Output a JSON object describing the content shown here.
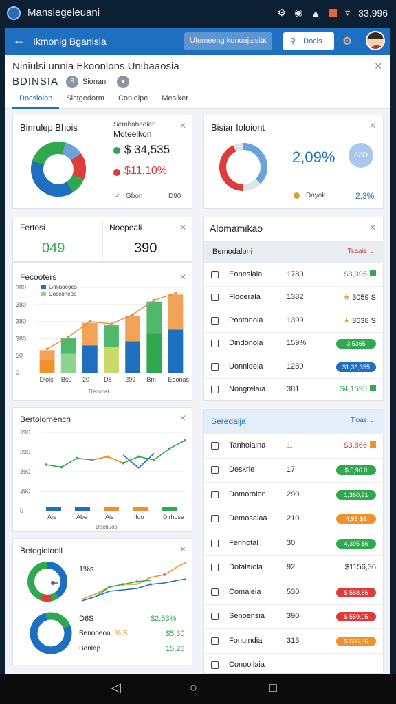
{
  "status": {
    "title": "Mansiegeleuani",
    "time": "33.996"
  },
  "appbar": {
    "title": "Ikmonig Bganisia",
    "search_placeholder": "Ufemeeng konoajaisin",
    "search_button": "Docis"
  },
  "header": {
    "line1": "Niniulsi unnia Ekoonlons Unibaaosia",
    "line2": "BDINSIA",
    "chip1_label": "Sionan",
    "tabs": [
      "Docsiolon",
      "Sictgedorm",
      "Conlolpe",
      "Mesiker"
    ]
  },
  "card_a": {
    "title": "Binrulep Bhois",
    "sub_title": "Sembabadien",
    "sub_title2": "Moteelkon",
    "value1": "$ 34,535",
    "value2": "$11,10%",
    "foot_left": "Gbon",
    "foot_right": "D90"
  },
  "card_b": {
    "title": "Bisiar Ioloiont",
    "percent": "2,09%",
    "pill": "32D",
    "foot_left": "Doyok",
    "foot_right": "2,3%"
  },
  "card_c": {
    "title": "Fertosi",
    "value": "049",
    "title2": "Noepeali",
    "value2": "390"
  },
  "card_bar": {
    "title": "Fecooters",
    "legend": [
      "Gmiuoeoes",
      "Cocconeoa"
    ],
    "yticks": [
      "380",
      "380",
      "380",
      "380",
      "50",
      "0"
    ],
    "xticks": [
      "Diols",
      "Bs0",
      "20",
      "D8",
      "209",
      "Bm",
      "Eeonas"
    ],
    "xlabel": "Decooet",
    "chart_data": {
      "type": "bar",
      "series": [
        {
          "name": "Gmiuoeoes",
          "values": [
            95,
            145,
            210,
            200,
            240,
            300,
            330
          ]
        },
        {
          "name": "Cocconeoa",
          "values": [
            0,
            120,
            0,
            150,
            0,
            290,
            270
          ]
        }
      ]
    }
  },
  "card_line": {
    "title": "Bertolomench",
    "yticks": [
      "390",
      "390",
      "390",
      "390",
      "0"
    ],
    "xticks": [
      "Ais",
      "Abe",
      "Ais",
      "Iloo",
      "Dirhosa"
    ],
    "xlabel": "Decbuos",
    "chart_data": {
      "type": "line",
      "series": [
        {
          "name": "",
          "values": [
            200,
            185,
            240,
            230,
            250,
            210,
            250,
            230,
            300,
            350
          ]
        },
        {
          "name": "",
          "values": [
            0,
            0,
            0,
            0,
            0,
            260,
            180,
            270,
            0,
            0
          ]
        }
      ]
    }
  },
  "card_mini": {
    "title": "Betogiolooil",
    "label_top": "1%s",
    "bottom_label": "D6S",
    "bottom_value": "$2,53%",
    "row1_label": "Benooeon",
    "row1_sub": "% S",
    "row1_value": "$5,30",
    "row2_label": "Benlap",
    "row2_value": "15,26"
  },
  "table1": {
    "title": "Alomamikao",
    "header_left": "Bemodalpni",
    "header_right": "Tsaais",
    "rows": [
      {
        "name": "Eonesiala",
        "value": "1780",
        "right": "$3,395",
        "style": "green-text"
      },
      {
        "name": "Flooerala",
        "value": "1382",
        "right": "3059 S",
        "style": "star"
      },
      {
        "name": "Pontonola",
        "value": "1399",
        "right": "3638 S",
        "style": "star"
      },
      {
        "name": "Dindonola",
        "value": "159%",
        "right": "3,5365",
        "style": "badge-green"
      },
      {
        "name": "Uonnidela",
        "value": "1280",
        "right": "$1,36,355",
        "style": "badge-blue"
      },
      {
        "name": "Nongrelaia",
        "value": "381",
        "right": "$4,1595",
        "style": "green-text"
      }
    ]
  },
  "table2": {
    "title": "Seredalja",
    "header_right": "Tioas",
    "rows": [
      {
        "name": "Tanholaina",
        "value": "1.",
        "right": "$3,866",
        "style": "red-text"
      },
      {
        "name": "Deskrie",
        "value": "17",
        "right": "$ 5,96 0",
        "style": "badge-green"
      },
      {
        "name": "Domorolon",
        "value": "290",
        "right": "1,360,91",
        "style": "badge-green"
      },
      {
        "name": "Demosalaa",
        "value": "210",
        "right": "4,98 $6",
        "style": "badge-orange"
      },
      {
        "name": "Fenhotal",
        "value": "30",
        "right": "4,395 $6",
        "style": "badge-green"
      },
      {
        "name": "Dotalaiola",
        "value": "92",
        "right": "$1156,36",
        "style": "plain"
      },
      {
        "name": "Comaleia",
        "value": "530",
        "right": "$ 588,86",
        "style": "badge-red"
      },
      {
        "name": "Senoensia",
        "value": "390",
        "right": "$ 559,05",
        "style": "badge-red"
      },
      {
        "name": "Fonuindia",
        "value": "313",
        "right": "$ 566,96",
        "style": "badge-orange"
      },
      {
        "name": "Conooilaia",
        "value": "",
        "right": "",
        "style": "plain"
      }
    ]
  },
  "colors": {
    "blue": "#1f6fc0",
    "green": "#2fa84f",
    "red": "#e03a3a",
    "orange": "#f0912c"
  }
}
